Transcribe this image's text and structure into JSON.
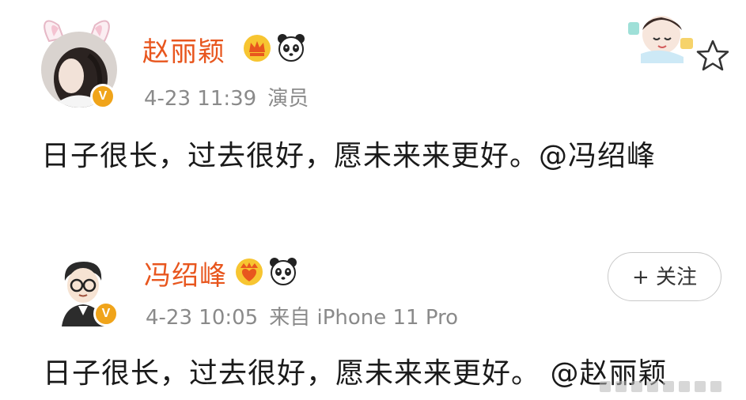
{
  "posts": [
    {
      "username": "赵丽颖",
      "time": "4-23 11:39",
      "source": "演员",
      "content": "日子很长，过去很好，愿未来来更好。@冯绍峰",
      "verified_mark": "V",
      "badges": [
        "crown-badge-icon",
        "panda-icon"
      ]
    },
    {
      "username": "冯绍峰",
      "time": "4-23 10:05",
      "source": "来自 iPhone 11 Pro",
      "content": "日子很长，过去很好，愿未来来更好。 @赵丽颖",
      "verified_mark": "V",
      "badges": [
        "heart-crown-badge-icon",
        "panda-icon"
      ],
      "follow_label": "+ 关注"
    }
  ],
  "colors": {
    "username": "#e8561e",
    "meta": "#8a8a8a",
    "content": "#1a1a1a",
    "verified": "#f0a41a"
  }
}
